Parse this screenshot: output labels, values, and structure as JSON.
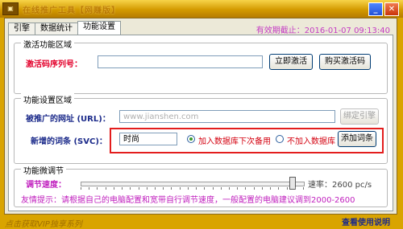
{
  "window": {
    "title": "在线推广工具【网赚版】",
    "minimize": "_",
    "close": "✕"
  },
  "tabs": [
    {
      "label": "引擎"
    },
    {
      "label": "数据统计"
    },
    {
      "label": "功能设置"
    }
  ],
  "expiry": "有效期截止：2016-01-07 09:13:40",
  "activation": {
    "group_title": "激活功能区域",
    "serial_label": "激活码序列号：",
    "serial_value": "",
    "activate_button": "立即激活",
    "buy_button": "购买激活码"
  },
  "settings": {
    "group_title": "功能设置区域",
    "url_label": "被推广的网址 (URL)：",
    "url_value": "www.jianshen.com",
    "bind_button": "绑定引擎",
    "svc_label": "新增的词条 (SVC)：",
    "svc_value": "时尚",
    "radio_add": "加入数据库下次备用",
    "radio_no": "不加入数据库",
    "add_button": "添加词条"
  },
  "tuning": {
    "group_title": "功能微调节",
    "speed_label": "调节速度：",
    "speed_value": "速率：2600 pc/s",
    "slider_fraction": 0.96,
    "tip": "友情提示：请根据自己的电脑配置和宽带自行调节速度，一般配置的电脑建议调到2000-2600"
  },
  "footer": {
    "left_text": "点击获取VIP独享系列",
    "help_link": "查看使用说明"
  }
}
